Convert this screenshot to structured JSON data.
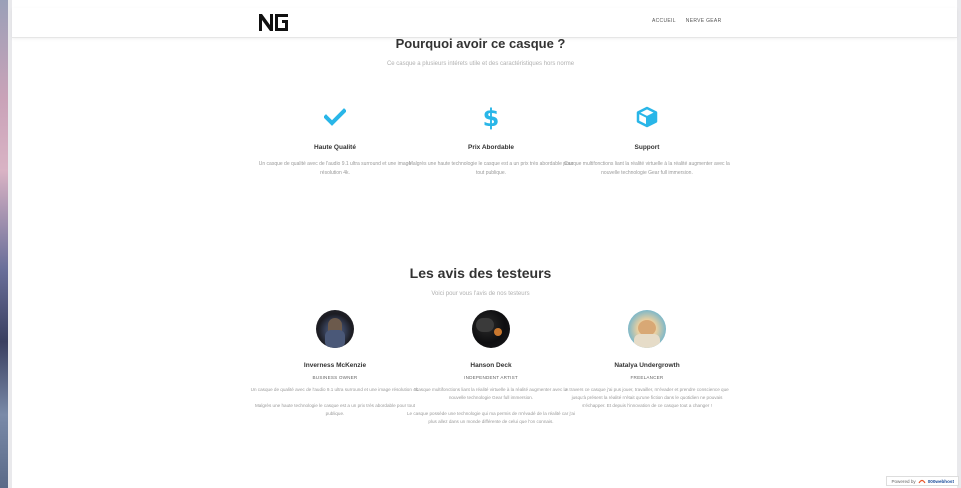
{
  "nav": {
    "links": [
      "ACCUEIL",
      "NERVE GEAR"
    ]
  },
  "why": {
    "title": "Pourquoi avoir ce casque ?",
    "subtitle": "Ce casque a plusieurs intérets utile et des caractéristiques hors norme",
    "features": [
      {
        "icon": "checkmark-icon",
        "title": "Haute Qualité",
        "text": "Un casque de qualité avec de l'audio 9.1 ultra surround et une image résolution 4k."
      },
      {
        "icon": "dollar-icon",
        "title": "Prix Abordable",
        "text": "Malgrès une haute technologie le casque est a un prix très abordable pour tout publique."
      },
      {
        "icon": "cube-icon",
        "title": "Support",
        "text": "Casque multifonctions liant la réalité virtuelle à la réalité augmenter avec la nouvelle technologie Gear full immersion."
      }
    ]
  },
  "reviews": {
    "title": "Les avis des testeurs",
    "subtitle": "Voici pour vous l'avis de nos testeurs",
    "testers": [
      {
        "name": "Inverness McKenzie",
        "role": "BUSINESS OWNER",
        "paragraphs": [
          "Un casque de qualité avec de l'audio 9.1 ultra surround et une image résolution 4k.",
          "Malgrès une haute technologie le casque est a un prix très abordable pour tout publique."
        ]
      },
      {
        "name": "Hanson Deck",
        "role": "INDEPENDENT ARTIST",
        "paragraphs": [
          "Casque multifonctions liant la réalité virtuelle à la réalité augmenter avec la nouvelle technologie Gear full immersion.",
          "Le casque possède une technologie qui ma permis de m'évadé de la réalité car j'ai plus allez dans un monde différente de celui que l'on connais."
        ]
      },
      {
        "name": "Natalya Undergrowth",
        "role": "FREELANCER",
        "paragraphs": [
          "A travers ce casque j'ai pus jouer, travailler, m'évader et prendre conscience que jusqu'à présent la réalité n'était qu'une fiction dans le quotidien ne pouvais s'échapper. Et depuis l'innovation de ce casque tout a changer !"
        ]
      }
    ]
  },
  "footer": {
    "powered_label": "Powered by",
    "powered_brand": "000webhost"
  },
  "colors": {
    "accent": "#29b6e8"
  }
}
